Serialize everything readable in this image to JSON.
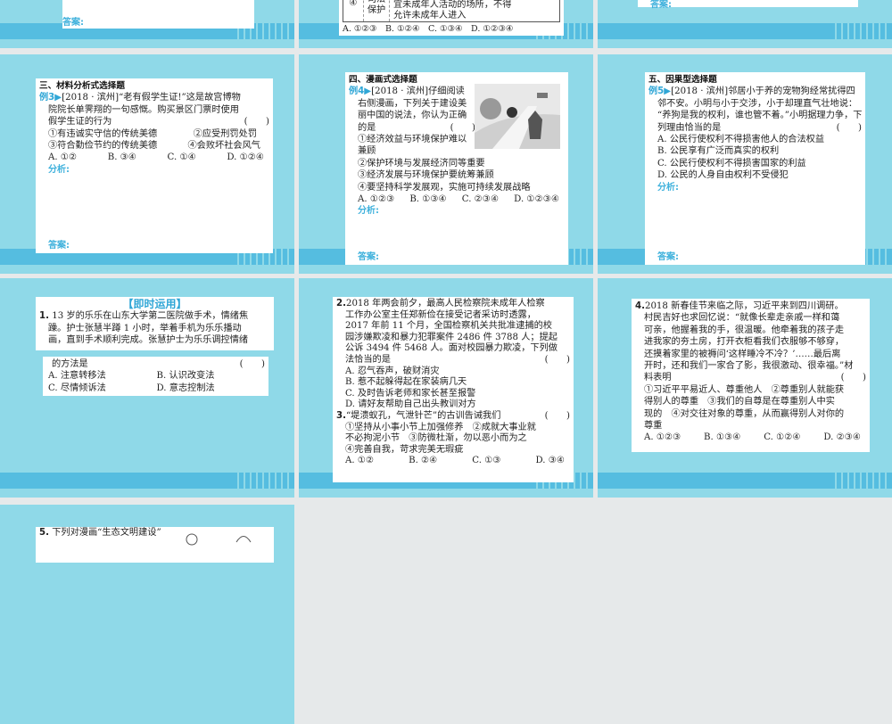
{
  "slides": {
    "s1": {
      "answer": "答案:"
    },
    "s2": {
      "cell_num": "④",
      "cell_label": "司法保护",
      "cell_text1": "宜未成年人活动的场所，不得",
      "cell_text2": "允许未成年人进入",
      "options": "A. ①②③　B. ①②④　C. ①③④　D. ①②③④"
    },
    "s3": {
      "answer": "答案:"
    },
    "s4": {
      "heading": "三、材料分析式选择题",
      "example": "例3▶",
      "lines": [
        "[2018 · 滨州]“老有假学生证!”这是故宫博物",
        "院院长单霁翔的一句感慨。购买景区门票时使用",
        "假学生证的行为"
      ],
      "bracket": "(　　)",
      "items": [
        "①有违诚实守信的传统美德",
        "②应受刑罚处罚",
        "③符合勤俭节约的传统美德",
        "④会败坏社会风气"
      ],
      "options": [
        "A. ①②",
        "B. ③④",
        "C. ①④",
        "D. ①②④"
      ],
      "analysis": "分析:",
      "answer": "答案:"
    },
    "s5": {
      "heading": "四、漫画式选择题",
      "example": "例4▶",
      "lines": [
        "[2018 · 滨州]仔细阅读",
        "右侧漫画，下列关于建设美",
        "丽中国的说法，你认为正确",
        "的是"
      ],
      "bracket": "(　　)",
      "items": [
        "①经济效益与环境保护难以",
        "兼顾",
        "②保护环境与发展经济同等重要",
        "③经济发展与环境保护要统筹兼顾",
        "④要坚持科学发展观，实施可持续发展战略"
      ],
      "options": [
        "A. ①②③",
        "B. ①③④",
        "C. ②③④",
        "D. ①②③④"
      ],
      "analysis": "分析:",
      "answer": "答案:"
    },
    "s6": {
      "heading": "五、因果型选择题",
      "example": "例5▶",
      "lines": [
        "[2018 · 滨州]邻居小于养的宠物狗经常扰得四",
        "邻不安。小明与小于交涉，小于却理直气壮地说：",
        "“养狗是我的权利，谁也管不着。”小明据理力争，下",
        "列理由恰当的是"
      ],
      "bracket": "(　　)",
      "options": [
        "A. 公民行使权利不得损害他人的合法权益",
        "B. 公民享有广泛而真实的权利",
        "C. 公民行使权利不得损害国家的利益",
        "D. 公民的人身自由权利不受侵犯"
      ],
      "analysis": "分析:",
      "answer": "答案:"
    },
    "s7": {
      "title": "【即时运用】",
      "num": "1.",
      "lines": [
        "13 岁的乐乐在山东大学第二医院做手术，情绪焦",
        "躁。护士张慧半蹲 1 小时，举着手机为乐乐播动",
        "画，直到手术顺利完成。张慧护士为乐乐调控情绪",
        "的方法是"
      ],
      "bracket": "(　　)",
      "options": [
        "A. 注意转移法",
        "B. 认识改变法",
        "C. 尽情倾诉法",
        "D. 意志控制法"
      ]
    },
    "s8": {
      "num2": "2.",
      "q2_lines": [
        "2018 年两会前夕，最高人民检察院未成年人检察",
        "工作办公室主任郑新俭在接受记者采访时透露，",
        "2017 年前 11 个月，全国检察机关共批准逮捕的校",
        "园涉嫌欺凌和暴力犯罪案件 2486 件 3788 人；提起",
        "公诉 3494 件 5468 人。面对校园暴力欺凌，下列做",
        "法恰当的是"
      ],
      "bracket": "(　　)",
      "q2_options": [
        "A. 忍气吞声，破财消灾",
        "B. 惹不起躲得起在家装病几天",
        "C. 及时告诉老师和家长甚至报警",
        "D. 请好友帮助自己出头教训对方"
      ],
      "num3": "3.",
      "q3_stem": "“堤溃蚁孔，气泄针芒”的古训告诫我们",
      "q3_lines": [
        "①坚持从小事小节上加强修养　②成就大事业就",
        "不必拘泥小节　③防微杜渐，勿以恶小而为之",
        "④完善自我，苛求完美无瑕疵"
      ],
      "q3_options": [
        "A. ①②",
        "B. ②④",
        "C. ①③",
        "D. ③④"
      ]
    },
    "s9": {
      "num": "4.",
      "lines": [
        "2018 新春佳节来临之际，习近平来到四川调研。",
        "村民吉好也求回忆说：“就像长辈走亲戚一样和蔼",
        "可亲，他握着我的手，很温暖。他牵着我的孩子走",
        "进我家的夯土房，打开衣柜看我们衣服够不够穿，",
        "还摸着家里的被褥问‘这样睡冷不冷？’……最后离",
        "开时，还和我们一家合了影，我很激动、很幸福。”材",
        "料表明"
      ],
      "bracket": "(　　)",
      "items": [
        "①习近平平易近人、尊重他人　②尊重别人就能获",
        "得别人的尊重　③我们的自尊是在尊重别人中实",
        "现的　④对交往对象的尊重，从而赢得别人对你的",
        "尊重"
      ],
      "options": [
        "A. ①②③",
        "B. ①③④",
        "C. ①②④",
        "D. ②③④"
      ]
    },
    "s10": {
      "num": "5.",
      "text": "下列对漫画“生态文明建设”"
    }
  }
}
